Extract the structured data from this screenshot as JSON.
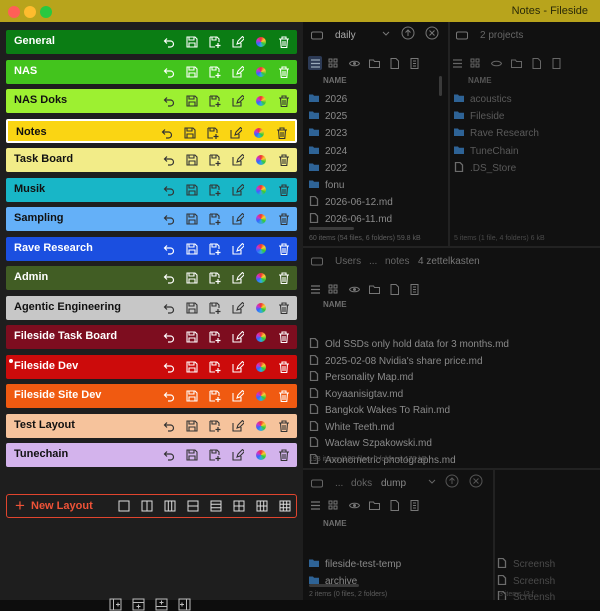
{
  "window": {
    "title": "Notes - Fileside"
  },
  "layouts": [
    {
      "label": "General",
      "color": "#0b7d14",
      "dark_text": false
    },
    {
      "label": "NAS",
      "color": "#43c41d",
      "dark_text": false
    },
    {
      "label": "NAS Doks",
      "color": "#9df031",
      "dark_text": true
    },
    {
      "label": "Notes",
      "color": "#fad513",
      "dark_text": true,
      "selected": true
    },
    {
      "label": "Task Board",
      "color": "#f2ec88",
      "dark_text": true
    },
    {
      "label": "Musik",
      "color": "#18b6c7",
      "dark_text": true
    },
    {
      "label": "Sampling",
      "color": "#64b0f8",
      "dark_text": true
    },
    {
      "label": "Rave Research",
      "color": "#1b4fe0",
      "dark_text": false
    },
    {
      "label": "Admin",
      "color": "#415d24",
      "dark_text": false
    },
    {
      "label": "Agentic Engineering",
      "color": "#c7c7c7",
      "dark_text": true
    },
    {
      "label": "Fileside Task Board",
      "color": "#7d0d1f",
      "dark_text": false
    },
    {
      "label": "Fileside Dev",
      "color": "#cc0b0b",
      "dark_text": false,
      "dot": true
    },
    {
      "label": "Fileside Site Dev",
      "color": "#f05a11",
      "dark_text": false
    },
    {
      "label": "Test Layout",
      "color": "#f6c39c",
      "dark_text": true
    },
    {
      "label": "Tunechain",
      "color": "#d3b3ec",
      "dark_text": true
    }
  ],
  "new_layout": {
    "label": "New Layout"
  },
  "pane1": {
    "path": "daily",
    "col": "NAME",
    "files": [
      {
        "name": "2026",
        "icon": "folder"
      },
      {
        "name": "2025",
        "icon": "folder"
      },
      {
        "name": "2023",
        "icon": "folder"
      },
      {
        "name": "2024",
        "icon": "folder"
      },
      {
        "name": "2022",
        "icon": "folder"
      },
      {
        "name": "fonu",
        "icon": "folder"
      },
      {
        "name": "2026-06-12.md",
        "icon": "doc"
      },
      {
        "name": "2026-06-11.md",
        "icon": "doc"
      }
    ],
    "status": "60 items (54 files, 6 folders) 59.8 kB"
  },
  "pane2": {
    "path": "2 projects",
    "col": "NAME",
    "files": [
      {
        "name": "acoustics",
        "icon": "folder"
      },
      {
        "name": "Fileside",
        "icon": "folder"
      },
      {
        "name": "Rave Research",
        "icon": "folder"
      },
      {
        "name": "TuneChain",
        "icon": "folder"
      },
      {
        "name": ".DS_Store",
        "icon": "doc"
      }
    ],
    "status": "5 items (1 file, 4 folders) 6 kB"
  },
  "pane3": {
    "crumb1": "Users",
    "crumb2": "...",
    "crumb3": "notes",
    "crumb4": "4 zettelkasten",
    "col": "NAME",
    "files": [
      "Old SSDs only hold data for 3 months.md",
      "2025-02-08 Nvidia's share price.md",
      "Personality Map.md",
      "Koyaanisigtav.md",
      "Bangkok Wakes To Rain.md",
      "White Teeth.md",
      "Wacław Szpakowski.md",
      "Axonometric photographs.md"
    ],
    "status": "198 items (198 files, 0 folders) 170 kB"
  },
  "pane4": {
    "crumb1": "...",
    "crumb2": "doks",
    "crumb3": "dump",
    "col": "NAME",
    "files": [
      {
        "name": "fileside-test-temp",
        "icon": "folder"
      },
      {
        "name": "archive",
        "icon": "folder"
      }
    ],
    "status": "2 items (0 files, 2 folders)"
  },
  "pane5": {
    "files": [
      "Screensh",
      "Screensh",
      "Screensh"
    ],
    "status": "3 items (3 f"
  }
}
